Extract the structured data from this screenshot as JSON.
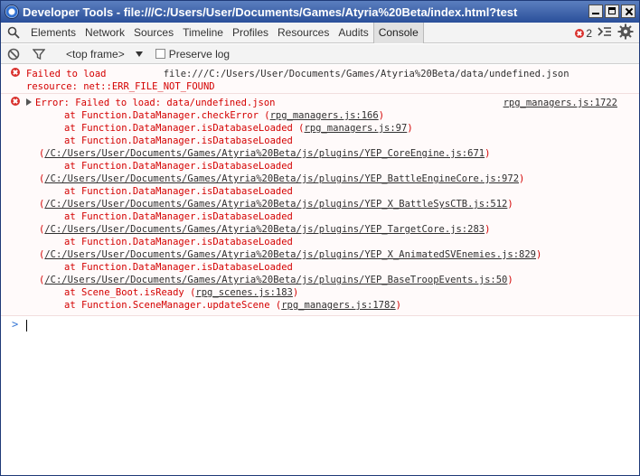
{
  "window": {
    "title": "Developer Tools - file:///C:/Users/User/Documents/Games/Atyria%20Beta/index.html?test"
  },
  "tabs": [
    "Elements",
    "Network",
    "Sources",
    "Timeline",
    "Profiles",
    "Resources",
    "Audits",
    "Console"
  ],
  "active_tab": "Console",
  "error_count": "2",
  "toolbar": {
    "frame_select": "<top frame>",
    "preserve_log": "Preserve log"
  },
  "messages": {
    "m1": {
      "prefix": "Failed to load",
      "url": "file:///C:/Users/User/Documents/Games/Atyria%20Beta/data/undefined.json",
      "reason": "resource: net::ERR_FILE_NOT_FOUND"
    },
    "m2": {
      "text": "Error: Failed to load: data/undefined.json",
      "source": "rpg_managers.js:1722",
      "stack": [
        {
          "pre": "at Function.DataManager.checkError (",
          "link": "rpg_managers.js:166",
          "post": ")",
          "indent": 1
        },
        {
          "pre": "at Function.DataManager.isDatabaseLoaded (",
          "link": "rpg_managers.js:97",
          "post": ")",
          "indent": 1
        },
        {
          "pre": "at Function.DataManager.isDatabaseLoaded",
          "link": "",
          "post": "",
          "indent": 1
        },
        {
          "pre": "(",
          "link": "/C:/Users/User/Documents/Games/Atyria%20Beta/js/plugins/YEP_CoreEngine.js:671",
          "post": ")",
          "indent": 0
        },
        {
          "pre": "at Function.DataManager.isDatabaseLoaded",
          "link": "",
          "post": "",
          "indent": 1
        },
        {
          "pre": "(",
          "link": "/C:/Users/User/Documents/Games/Atyria%20Beta/js/plugins/YEP_BattleEngineCore.js:972",
          "post": ")",
          "indent": 0
        },
        {
          "pre": "at Function.DataManager.isDatabaseLoaded",
          "link": "",
          "post": "",
          "indent": 1
        },
        {
          "pre": "(",
          "link": "/C:/Users/User/Documents/Games/Atyria%20Beta/js/plugins/YEP_X_BattleSysCTB.js:512",
          "post": ")",
          "indent": 0
        },
        {
          "pre": "at Function.DataManager.isDatabaseLoaded",
          "link": "",
          "post": "",
          "indent": 1
        },
        {
          "pre": "(",
          "link": "/C:/Users/User/Documents/Games/Atyria%20Beta/js/plugins/YEP_TargetCore.js:283",
          "post": ")",
          "indent": 0
        },
        {
          "pre": "at Function.DataManager.isDatabaseLoaded",
          "link": "",
          "post": "",
          "indent": 1
        },
        {
          "pre": "(",
          "link": "/C:/Users/User/Documents/Games/Atyria%20Beta/js/plugins/YEP_X_AnimatedSVEnemies.js:829",
          "post": ")",
          "indent": 0
        },
        {
          "pre": "at Function.DataManager.isDatabaseLoaded",
          "link": "",
          "post": "",
          "indent": 1
        },
        {
          "pre": "(",
          "link": "/C:/Users/User/Documents/Games/Atyria%20Beta/js/plugins/YEP_BaseTroopEvents.js:50",
          "post": ")",
          "indent": 0
        },
        {
          "pre": "at Scene_Boot.isReady (",
          "link": "rpg_scenes.js:183",
          "post": ")",
          "indent": 1
        },
        {
          "pre": "at Function.SceneManager.updateScene (",
          "link": "rpg_managers.js:1782",
          "post": ")",
          "indent": 1
        }
      ]
    }
  },
  "prompt": ">",
  "colors": {
    "error_text": "#d40000",
    "error_bg": "#fffafa",
    "prompt": "#3a79d6",
    "titlebar": "#2a4f9a"
  }
}
